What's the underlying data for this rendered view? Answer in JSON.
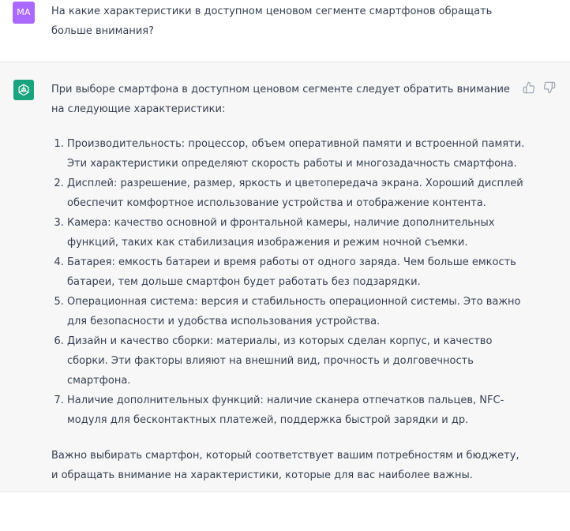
{
  "user": {
    "avatar_initials": "MA",
    "message": "На какие характеристики в доступном ценовом сегменте смартфонов обращать больше внимания?"
  },
  "assistant": {
    "avatar_icon": "openai-logo-icon",
    "intro": "При выборе смартфона в доступном ценовом сегменте следует обратить внимание на следующие характеристики:",
    "items": [
      "Производительность: процессор, объем оперативной памяти и встроенной памяти. Эти характеристики определяют скорость работы и многозадачность смартфона.",
      "Дисплей: разрешение, размер, яркость и цветопередача экрана. Хороший дисплей обеспечит комфортное использование устройства и отображение контента.",
      "Камера: качество основной и фронтальной камеры, наличие дополнительных функций, таких как стабилизация изображения и режим ночной съемки.",
      "Батарея: емкость батареи и время работы от одного заряда. Чем больше емкость батареи, тем дольше смартфон будет работать без подзарядки.",
      "Операционная система: версия и стабильность операционной системы. Это важно для безопасности и удобства использования устройства.",
      "Дизайн и качество сборки: материалы, из которых сделан корпус, и качество сборки. Эти факторы влияют на внешний вид, прочность и долговечность смартфона.",
      "Наличие дополнительных функций: наличие сканера отпечатков пальцев, NFC-модуля для бесконтактных платежей, поддержка быстрой зарядки и др."
    ],
    "conclusion": "Важно выбирать смартфон, который соответствует вашим потребностям и бюджету, и обращать внимание на характеристики, которые для вас наиболее важны.",
    "feedback_icons": [
      "thumbs-up-icon",
      "thumbs-down-icon"
    ]
  },
  "colors": {
    "user_avatar": "#ab68ff",
    "assistant_avatar": "#19a37f",
    "assistant_bg": "#f7f7f8",
    "text": "#374151"
  }
}
